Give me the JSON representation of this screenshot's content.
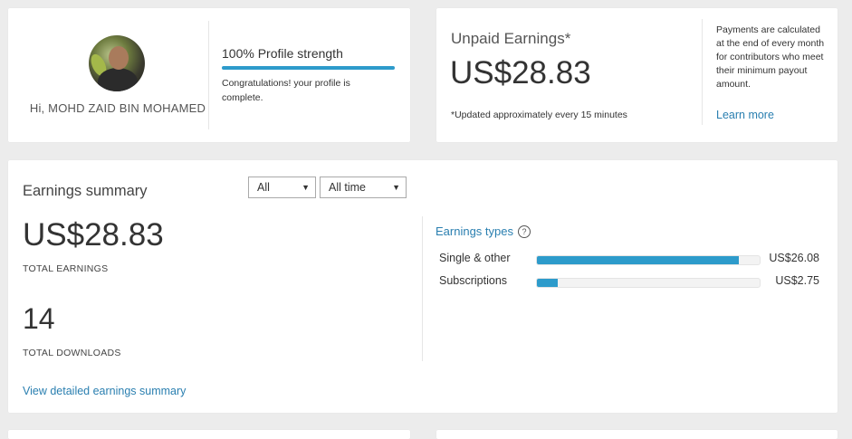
{
  "profile": {
    "greeting": "Hi, MOHD ZAID BIN MOHAMED",
    "strength_title": "100% Profile strength",
    "strength_fraction": 1.0,
    "strength_message": "Congratulations! your profile is complete."
  },
  "unpaid": {
    "title": "Unpaid Earnings*",
    "amount": "US$28.83",
    "note": "*Updated approximately every 15 minutes",
    "payout_info": "Payments are calculated at the end of every month for contributors who meet their minimum payout amount.",
    "learn_more": "Learn more"
  },
  "summary": {
    "title": "Earnings summary",
    "type_filter": "All",
    "time_filter": "All time",
    "total_earnings": "US$28.83",
    "total_earnings_label": "TOTAL EARNINGS",
    "total_downloads": "14",
    "total_downloads_label": "TOTAL DOWNLOADS",
    "detail_link": "View detailed earnings summary",
    "types_title": "Earnings types",
    "types": [
      {
        "label": "Single & other",
        "amount": "US$26.08",
        "fraction": 0.905
      },
      {
        "label": "Subscriptions",
        "amount": "US$2.75",
        "fraction": 0.095
      }
    ]
  },
  "colors": {
    "accent": "#2d9bcb",
    "link": "#2a7fb0",
    "background": "#ececec"
  },
  "icons": {
    "help": "question-circle-icon",
    "dropdown": "caret-down-icon"
  }
}
